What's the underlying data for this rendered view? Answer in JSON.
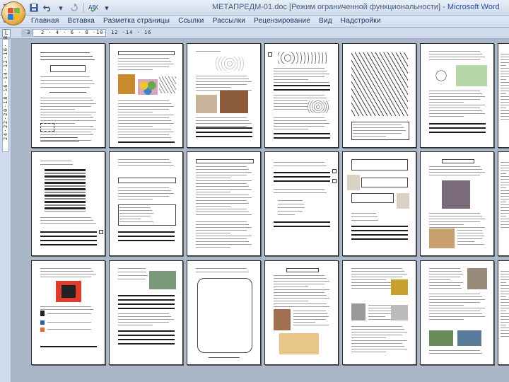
{
  "window": {
    "title": "МЕТАПРЕДМ-01.doc [Режим ограниченной функциональности]",
    "app_name": "Microsoft Word",
    "separator": " - "
  },
  "quick_access": {
    "save_icon": "save-icon",
    "undo_icon": "undo-icon",
    "redo_icon": "redo-icon",
    "spell_icon": "spellcheck-icon",
    "dropdown_glyph": "▾"
  },
  "ribbon_tabs": [
    {
      "label": "Главная"
    },
    {
      "label": "Вставка"
    },
    {
      "label": "Разметка страницы"
    },
    {
      "label": "Ссылки"
    },
    {
      "label": "Рассылки"
    },
    {
      "label": "Рецензирование"
    },
    {
      "label": "Вид"
    },
    {
      "label": "Надстройки"
    }
  ],
  "ruler": {
    "corner_glyph": "L",
    "left_number": "3",
    "top_numbers": "2 · 4 · 6 · 8 ·10· 12 ·14 · 16",
    "left_numbers": "24·22·20·18·16·14·12·10· 8 · 6 · 4 · 2 ·"
  },
  "colors": {
    "titlebar": "#dfe8f5",
    "ribbon_text": "#15315c",
    "workspace": "#a9b7c9",
    "office_button": "#e0a33a"
  }
}
